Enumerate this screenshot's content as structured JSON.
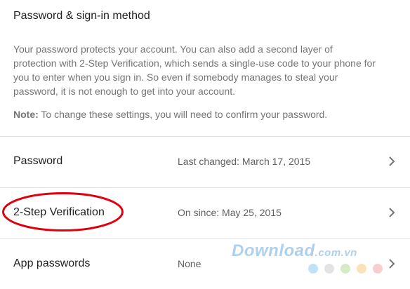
{
  "heading": "Password & sign-in method",
  "description": "Your password protects your account. You can also add a second layer of protection with 2-Step Verification, which sends a single-use code to your phone for you to enter when you sign in. So even if somebody manages to steal your password, it is not enough to get into your account.",
  "note": {
    "prefix": "Note:",
    "text": " To change these settings, you will need to confirm your password."
  },
  "rows": [
    {
      "label": "Password",
      "value": "Last changed: March 17, 2015",
      "icon": "chevron-right-icon"
    },
    {
      "label": "2-Step Verification",
      "value": "On since: May 25, 2015",
      "icon": "chevron-right-icon",
      "highlighted": true
    },
    {
      "label": "App passwords",
      "value": "None",
      "icon": "chevron-right-icon"
    }
  ],
  "highlight_color": "#e0000f",
  "watermark": {
    "brand": "Download",
    "suffix": ".com.vn"
  },
  "watermark_dots": [
    "#bfe3f5",
    "#e3e3e3",
    "#d5ecc6",
    "#fbe3b8",
    "#f8cfd0"
  ]
}
